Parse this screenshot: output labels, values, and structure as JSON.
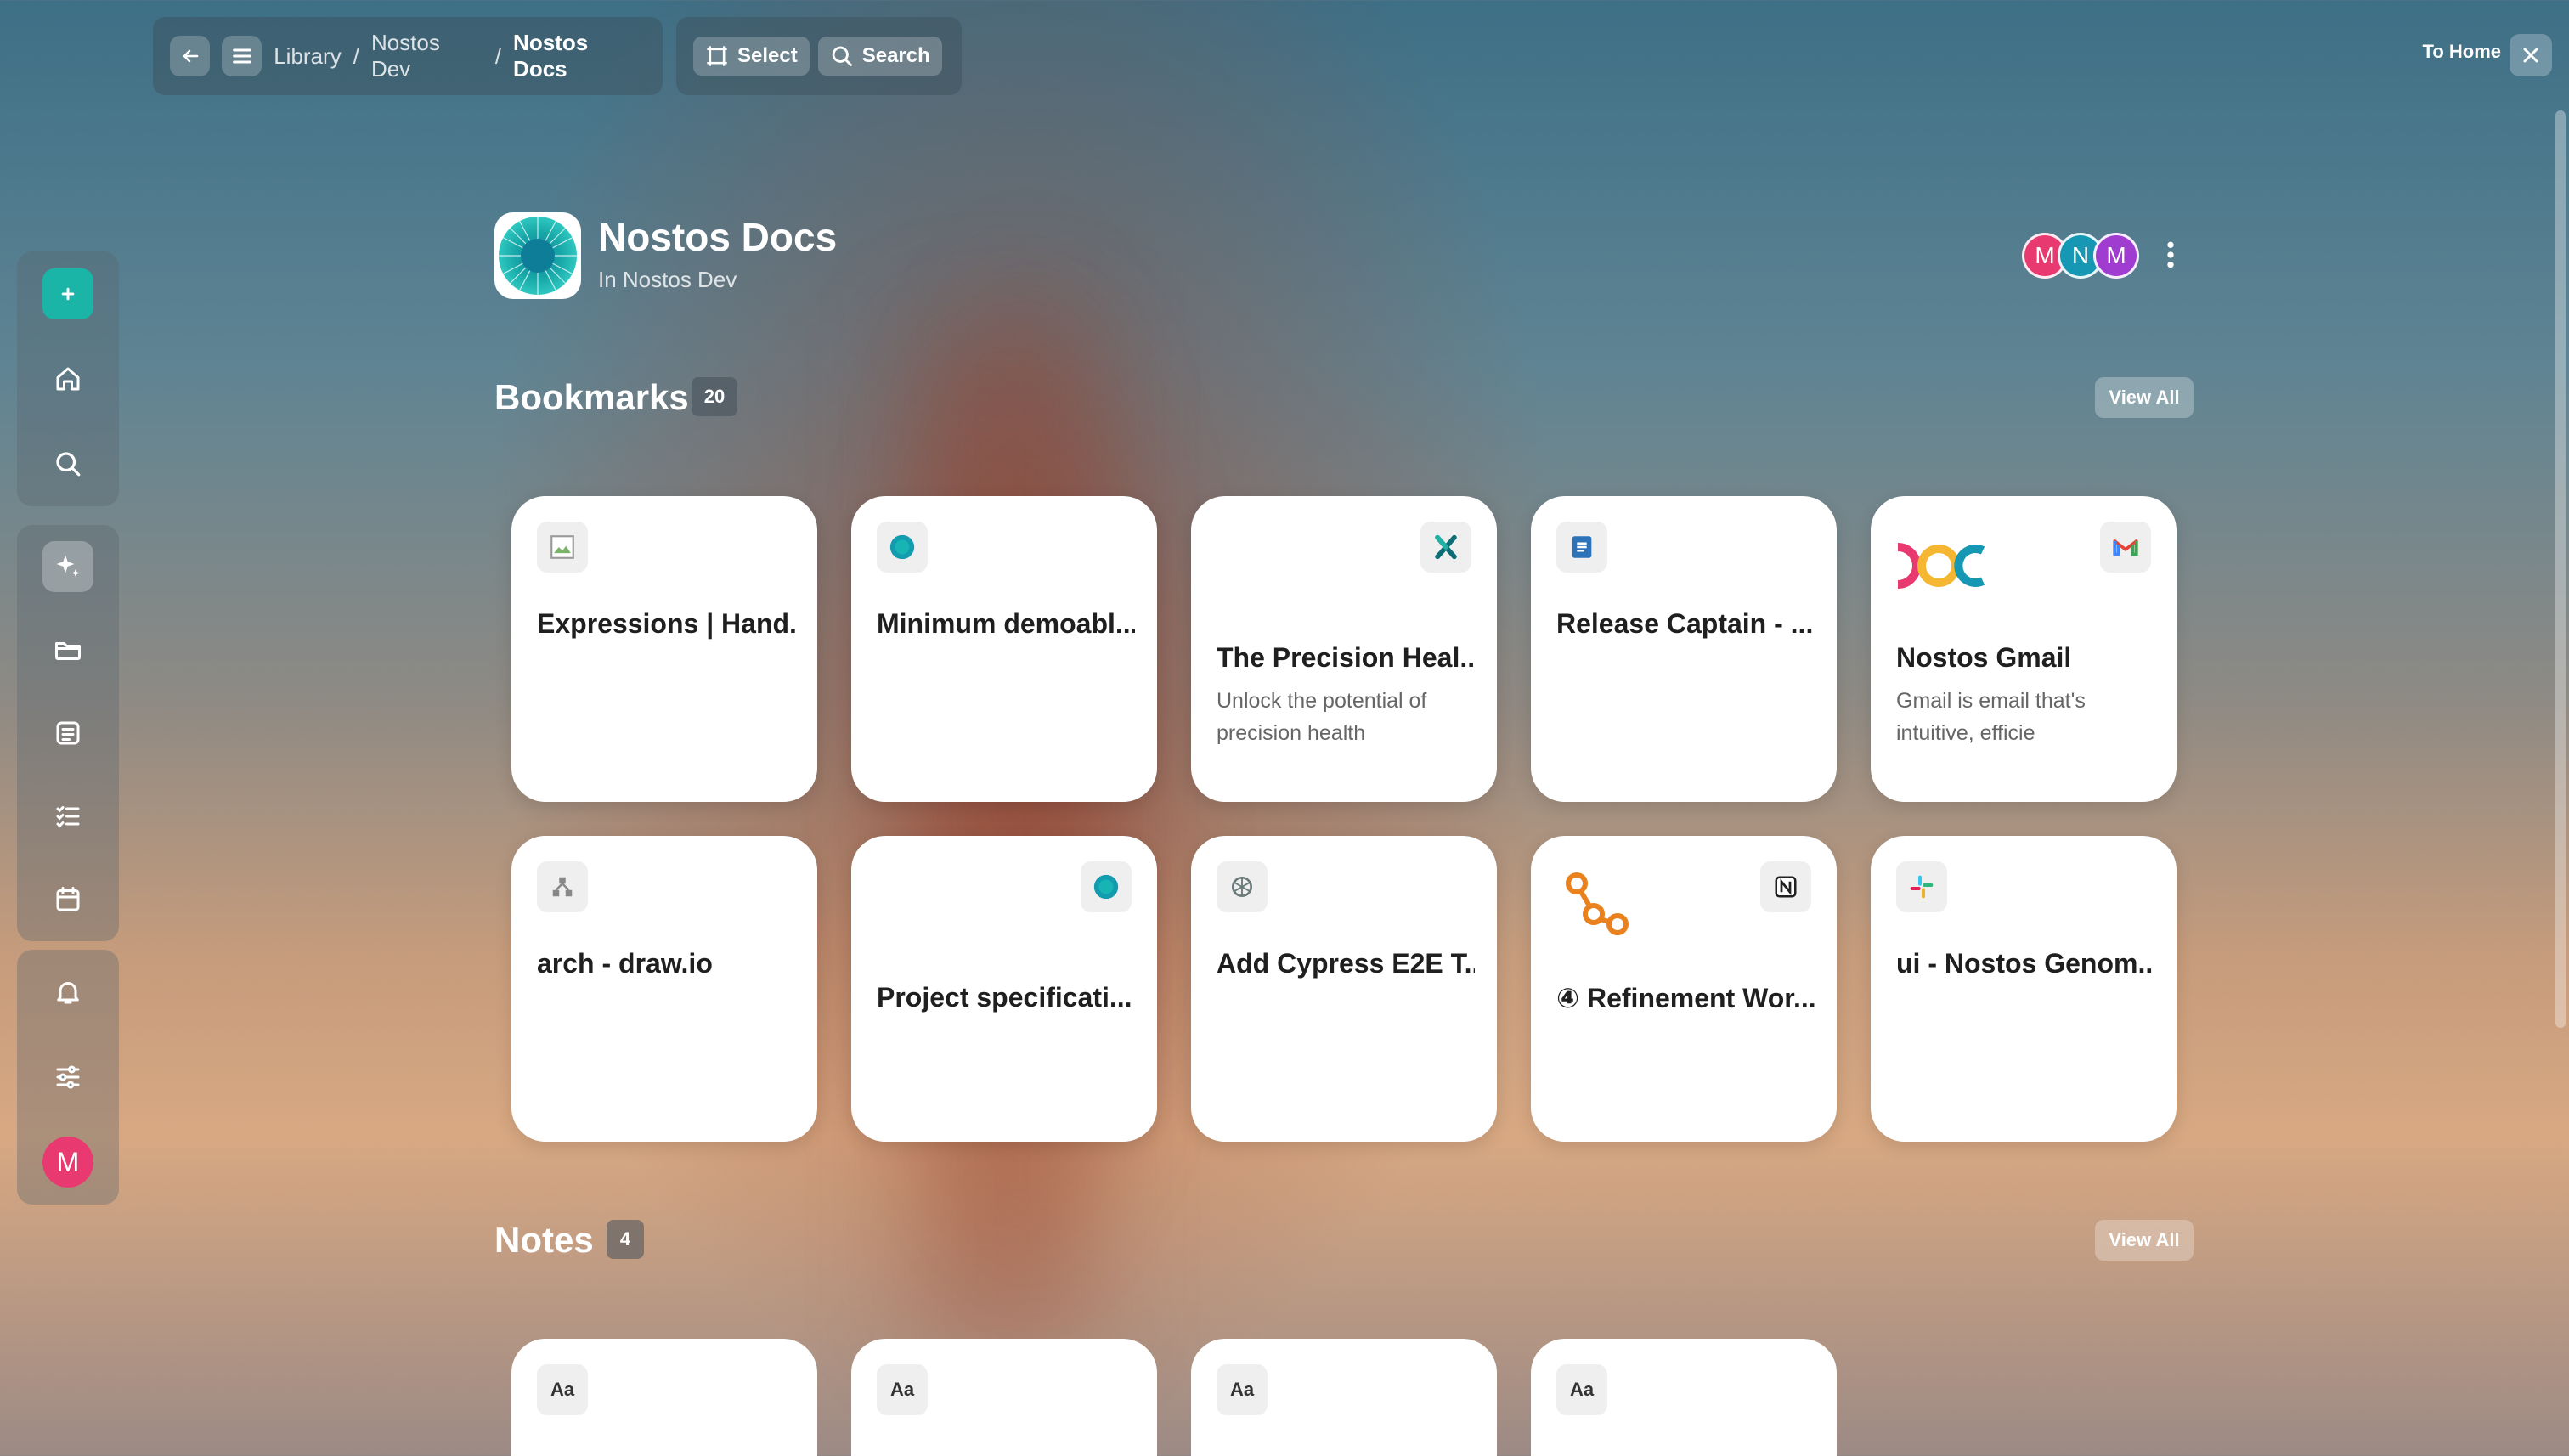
{
  "topbar": {
    "breadcrumbs": [
      "Library",
      "Nostos Dev",
      "Nostos Docs"
    ],
    "separator": "/",
    "select_label": "Select",
    "search_label": "Search",
    "to_home_label": "To Home"
  },
  "sidebar": {
    "avatar_initial": "M"
  },
  "space": {
    "title": "Nostos Docs",
    "subtitle": "In Nostos Dev",
    "members": [
      {
        "initial": "M",
        "color": "#e83a71"
      },
      {
        "initial": "N",
        "color": "#1697b3"
      },
      {
        "initial": "M",
        "color": "#a03cd0"
      }
    ]
  },
  "bookmarks": {
    "title": "Bookmarks",
    "count": "20",
    "view_all": "View All",
    "items": [
      {
        "title": "Expressions | Hand...",
        "description": ""
      },
      {
        "title": "Minimum demoabl...",
        "description": ""
      },
      {
        "title": "The Precision Heal...",
        "description": "Unlock the potential of precision health"
      },
      {
        "title": "Release Captain - ...",
        "description": ""
      },
      {
        "title": "Nostos Gmail",
        "description": "Gmail is email that's intuitive, efficie"
      },
      {
        "title": "arch - draw.io",
        "description": ""
      },
      {
        "title": "Project specificati...",
        "description": ""
      },
      {
        "title": "Add Cypress E2E T...",
        "description": ""
      },
      {
        "title": "④ Refinement Wor...",
        "description": ""
      },
      {
        "title": "ui - Nostos Genom...",
        "description": ""
      }
    ]
  },
  "notes": {
    "title": "Notes",
    "count": "4",
    "view_all": "View All",
    "icon_label": "Aa"
  }
}
